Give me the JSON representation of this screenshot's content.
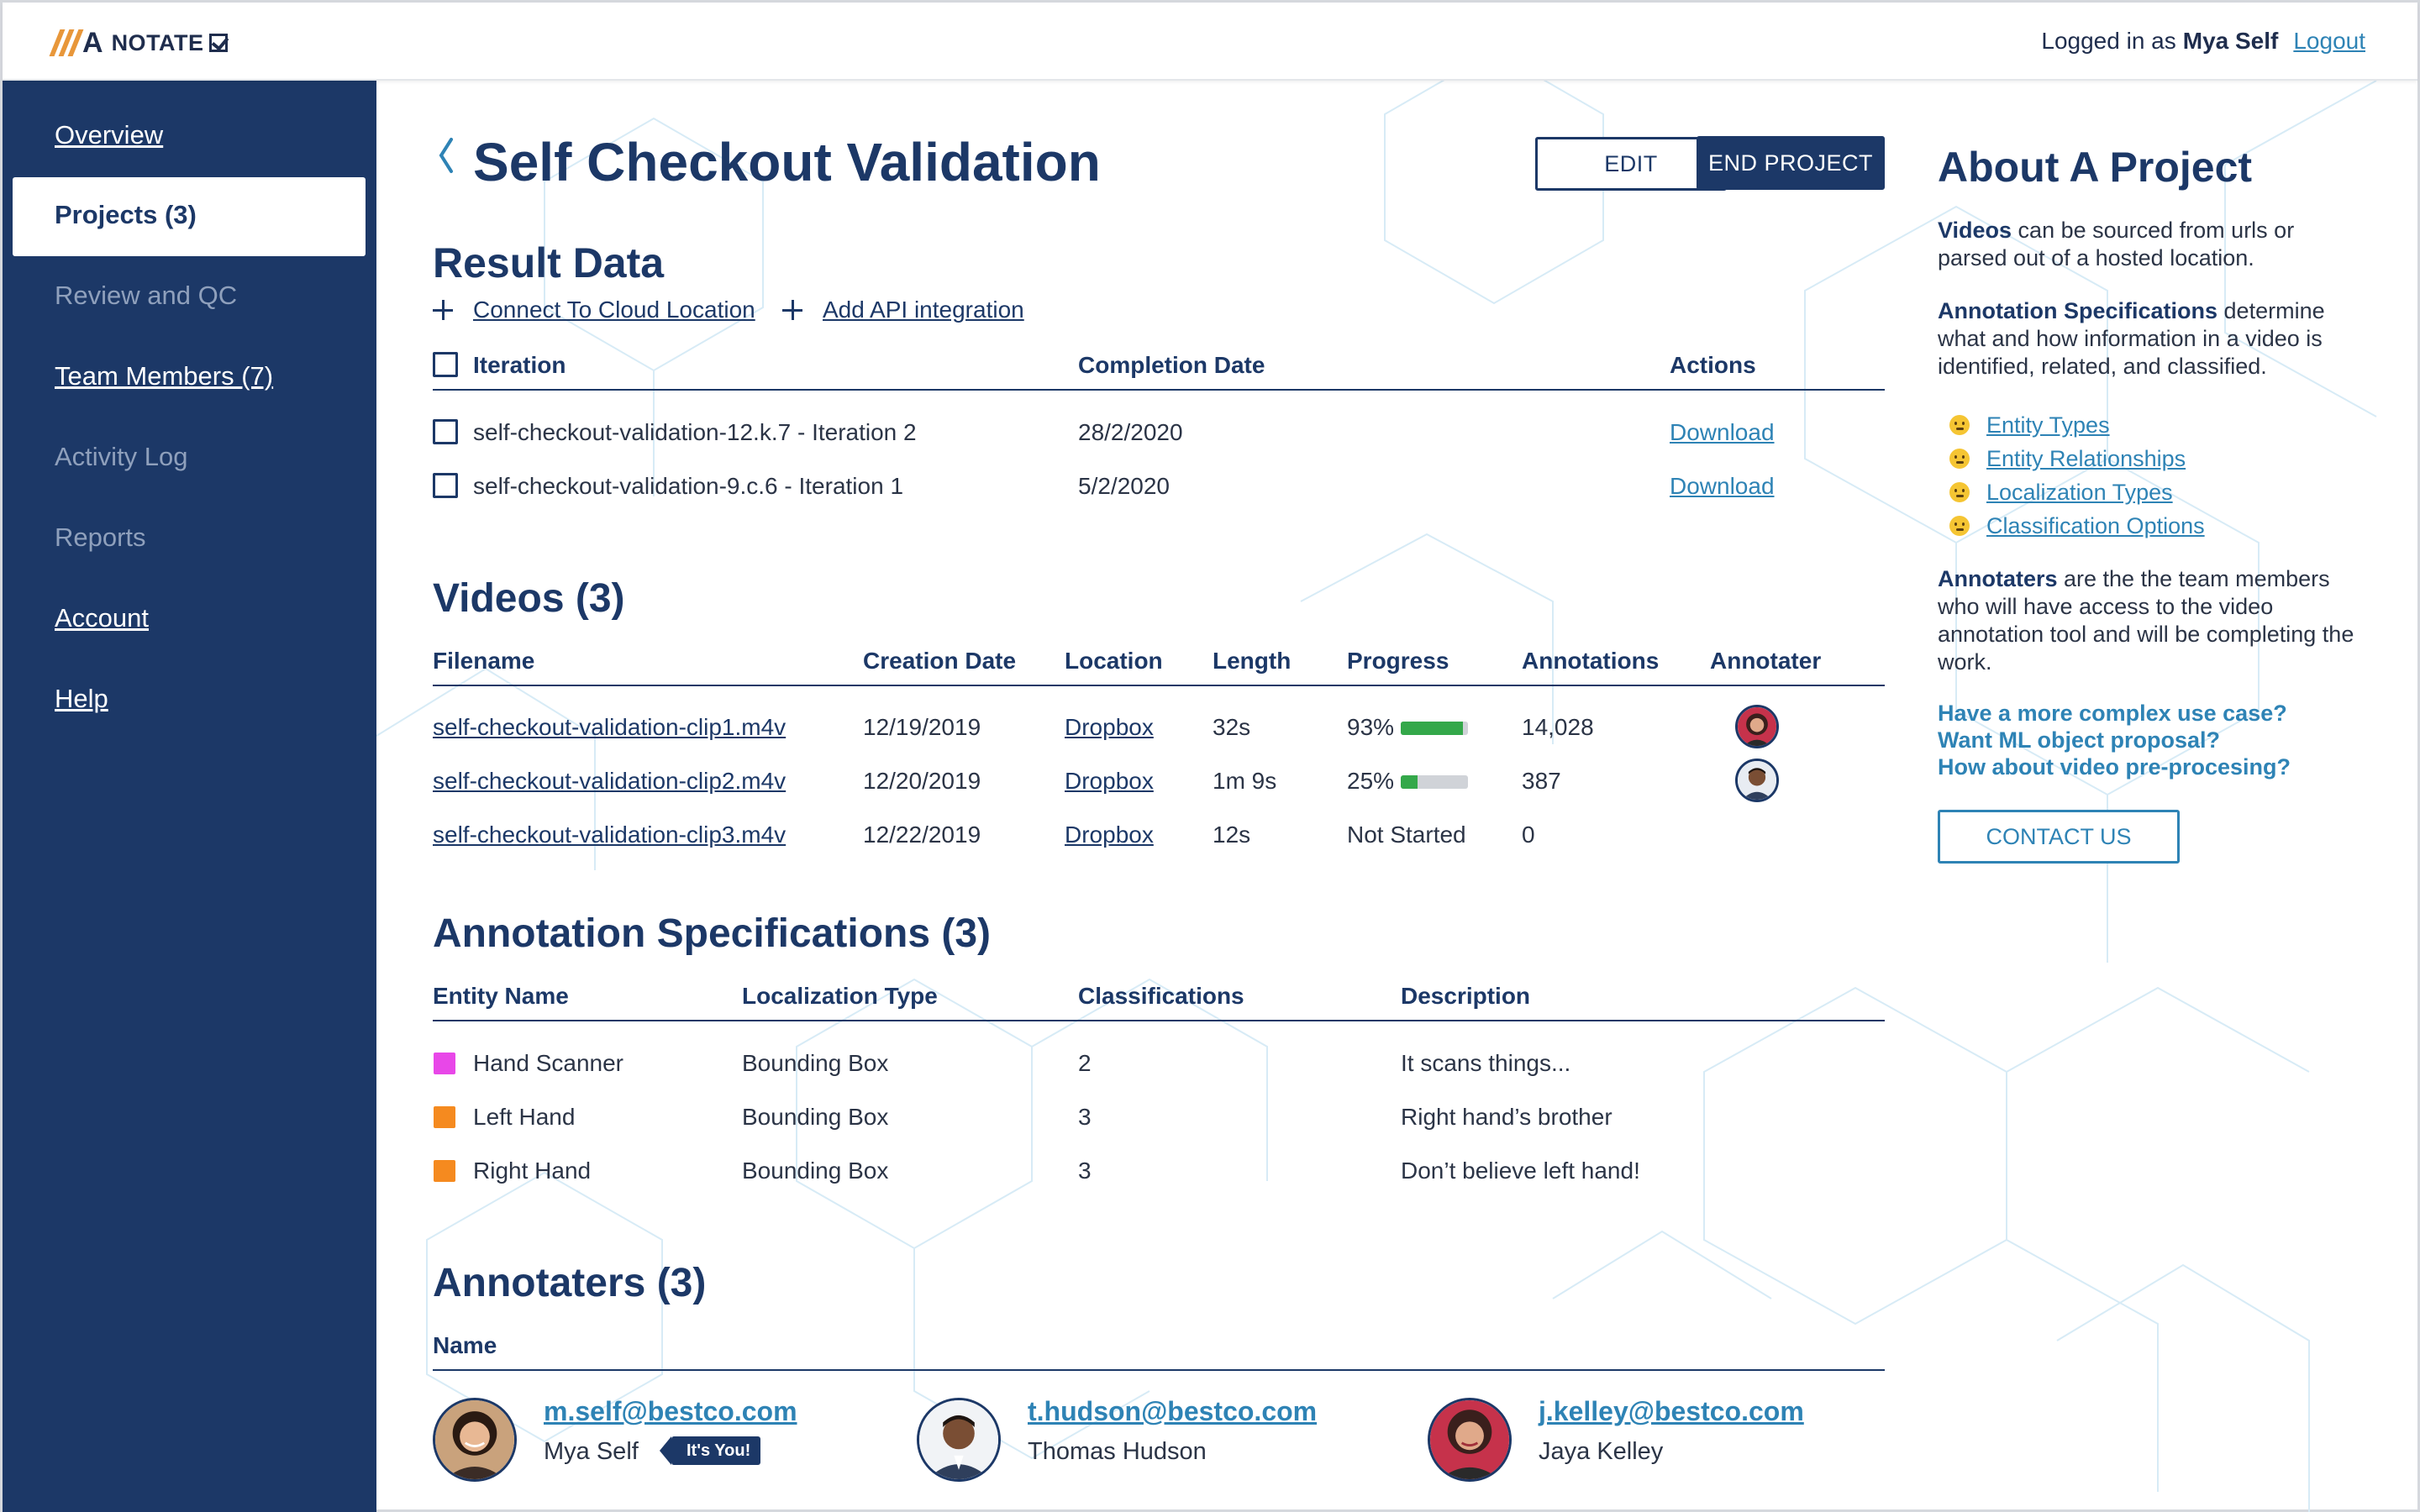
{
  "header": {
    "logo_text": "NOTATE",
    "logged_in_prefix": "Logged in as",
    "user_name": "Mya Self",
    "logout_label": "Logout"
  },
  "sidebar": {
    "items": [
      {
        "label": "Overview",
        "state": "link"
      },
      {
        "label": "Projects (3)",
        "state": "active"
      },
      {
        "label": "Review and QC",
        "state": "disabled"
      },
      {
        "label": "Team Members (7)",
        "state": "link"
      },
      {
        "label": "Activity Log",
        "state": "disabled"
      },
      {
        "label": "Reports",
        "state": "disabled"
      },
      {
        "label": "Account",
        "state": "link"
      },
      {
        "label": "Help",
        "state": "link"
      }
    ]
  },
  "project": {
    "title": "Self Checkout Validation",
    "edit_label": "EDIT",
    "end_label": "END PROJECT"
  },
  "result_data": {
    "title": "Result Data",
    "connect_label": "Connect To Cloud Location",
    "api_label": "Add API integration",
    "columns": [
      "Iteration",
      "Completion Date",
      "Actions"
    ],
    "rows": [
      {
        "iteration": "self-checkout-validation-12.k.7 - Iteration 2",
        "date": "28/2/2020",
        "action": "Download"
      },
      {
        "iteration": "self-checkout-validation-9.c.6 - Iteration 1",
        "date": "5/2/2020",
        "action": "Download"
      }
    ]
  },
  "videos": {
    "title": "Videos (3)",
    "columns": [
      "Filename",
      "Creation Date",
      "Location",
      "Length",
      "Progress",
      "Annotations",
      "Annotater"
    ],
    "rows": [
      {
        "filename": "self-checkout-validation-clip1.m4v",
        "date": "12/19/2019",
        "location": "Dropbox",
        "length": "32s",
        "progress_text": "93%",
        "progress": 0.93,
        "annotations": "14,028",
        "annotater": "female-avatar"
      },
      {
        "filename": "self-checkout-validation-clip2.m4v",
        "date": "12/20/2019",
        "location": "Dropbox",
        "length": "1m 9s",
        "progress_text": "25%",
        "progress": 0.25,
        "annotations": "387",
        "annotater": "male-avatar"
      },
      {
        "filename": "self-checkout-validation-clip3.m4v",
        "date": "12/22/2019",
        "location": "Dropbox",
        "length": "12s",
        "progress_text": "Not Started",
        "progress": null,
        "annotations": "0",
        "annotater": null
      }
    ]
  },
  "annotation_specs": {
    "title": "Annotation Specifications (3)",
    "columns": [
      "Entity Name",
      "Localization Type",
      "Classifications",
      "Description"
    ],
    "rows": [
      {
        "name": "Hand Scanner",
        "color": "#e847e8",
        "localization": "Bounding Box",
        "classifications": "2",
        "description": "It scans things..."
      },
      {
        "name": "Left Hand",
        "color": "#f58a1f",
        "localization": "Bounding Box",
        "classifications": "3",
        "description": "Right hand’s brother"
      },
      {
        "name": "Right Hand",
        "color": "#f58a1f",
        "localization": "Bounding Box",
        "classifications": "3",
        "description": "Don’t believe left hand!"
      }
    ]
  },
  "annotaters": {
    "title": "Annotaters (3)",
    "column": "Name",
    "people": [
      {
        "email": "m.self@bestco.com",
        "name": "Mya Self",
        "badge": "It's You!"
      },
      {
        "email": "t.hudson@bestco.com",
        "name": "Thomas Hudson",
        "badge": null
      },
      {
        "email": "j.kelley@bestco.com",
        "name": "Jaya Kelley",
        "badge": null
      }
    ]
  },
  "aside": {
    "title": "About A Project",
    "videos_bold": "Videos",
    "videos_text": " can be sourced from urls or parsed out of a hosted location.",
    "specs_bold": "Annotation Specifications",
    "specs_text": " determine what and how information in a video is identified, related, and classified.",
    "links": [
      "Entity Types",
      "Entity Relationships",
      "Localization Types",
      "Classification Options"
    ],
    "annotaters_bold": "Annotaters",
    "annotaters_text": " are the the team members who will have access to the video annotation tool and will be completing the work.",
    "questions": [
      "Have a more complex use case?",
      "Want ML object proposal?",
      "How about video pre-procesing?"
    ],
    "contact_label": "CONTACT US"
  },
  "colors": {
    "navy": "#1c3867",
    "link_blue": "#2e83b5",
    "progress_green": "#34a84a",
    "logo_orange": "#e8973a"
  }
}
